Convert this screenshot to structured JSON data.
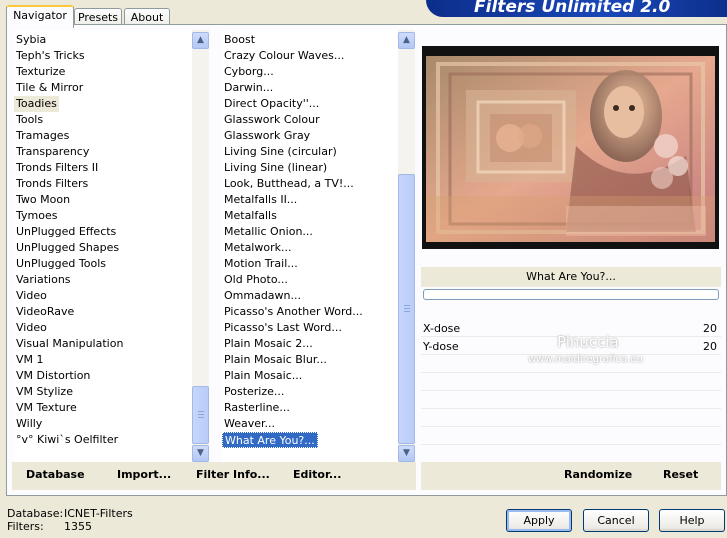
{
  "title": "Filters Unlimited 2.0",
  "tabs": [
    "Navigator",
    "Presets",
    "About"
  ],
  "categories": {
    "items": [
      "Sybia",
      "Teph's Tricks",
      "Texturize",
      "Tile & Mirror",
      "Toadies",
      "Tools",
      "Tramages",
      "Transparency",
      "Tronds Filters II",
      "Tronds Filters",
      "Two Moon",
      "Tymoes",
      "UnPlugged Effects",
      "UnPlugged Shapes",
      "UnPlugged Tools",
      "Variations",
      "Video",
      "VideoRave",
      "Video",
      "Visual Manipulation",
      "VM 1",
      "VM Distortion",
      "VM Stylize",
      "VM Texture",
      "Willy",
      "°v° Kiwi`s Oelfilter"
    ],
    "highlighted": "Toadies"
  },
  "filters": {
    "items": [
      "Boost",
      "Crazy Colour Waves...",
      "Cyborg...",
      "Darwin...",
      "Direct Opacity''...",
      "Glasswork Colour",
      "Glasswork Gray",
      "Living Sine (circular)",
      "Living Sine (linear)",
      "Look, Butthead, a TV!...",
      "Metalfalls II...",
      "Metalfalls",
      "Metallic Onion...",
      "Metalwork...",
      "Motion Trail...",
      "Old Photo...",
      "Ommadawn...",
      "Picasso's Another Word...",
      "Picasso's Last Word...",
      "Plain Mosaic 2...",
      "Plain Mosaic Blur...",
      "Plain Mosaic...",
      "Posterize...",
      "Rasterline...",
      "Weaver...",
      "What Are You?..."
    ],
    "selected": "What Are You?..."
  },
  "filter_name": "What Are You?...",
  "progress": 0,
  "params": [
    {
      "label": "X-dose",
      "value": "20"
    },
    {
      "label": "Y-dose",
      "value": "20"
    }
  ],
  "watermark": {
    "name": "Pinuccia",
    "url": "www.maidiregrafica.eu"
  },
  "toolbar": {
    "database": "Database",
    "import": "Import...",
    "filter_info": "Filter Info...",
    "editor": "Editor...",
    "randomize": "Randomize",
    "reset": "Reset"
  },
  "status": {
    "database_label": "Database:",
    "database_value": "ICNET-Filters",
    "filters_label": "Filters:",
    "filters_value": "1355"
  },
  "buttons": {
    "apply": "Apply",
    "cancel": "Cancel",
    "help": "Help"
  },
  "colors": {
    "selection": "#316ac5",
    "banner": "#1a47b8",
    "face": "#ece9d8"
  }
}
